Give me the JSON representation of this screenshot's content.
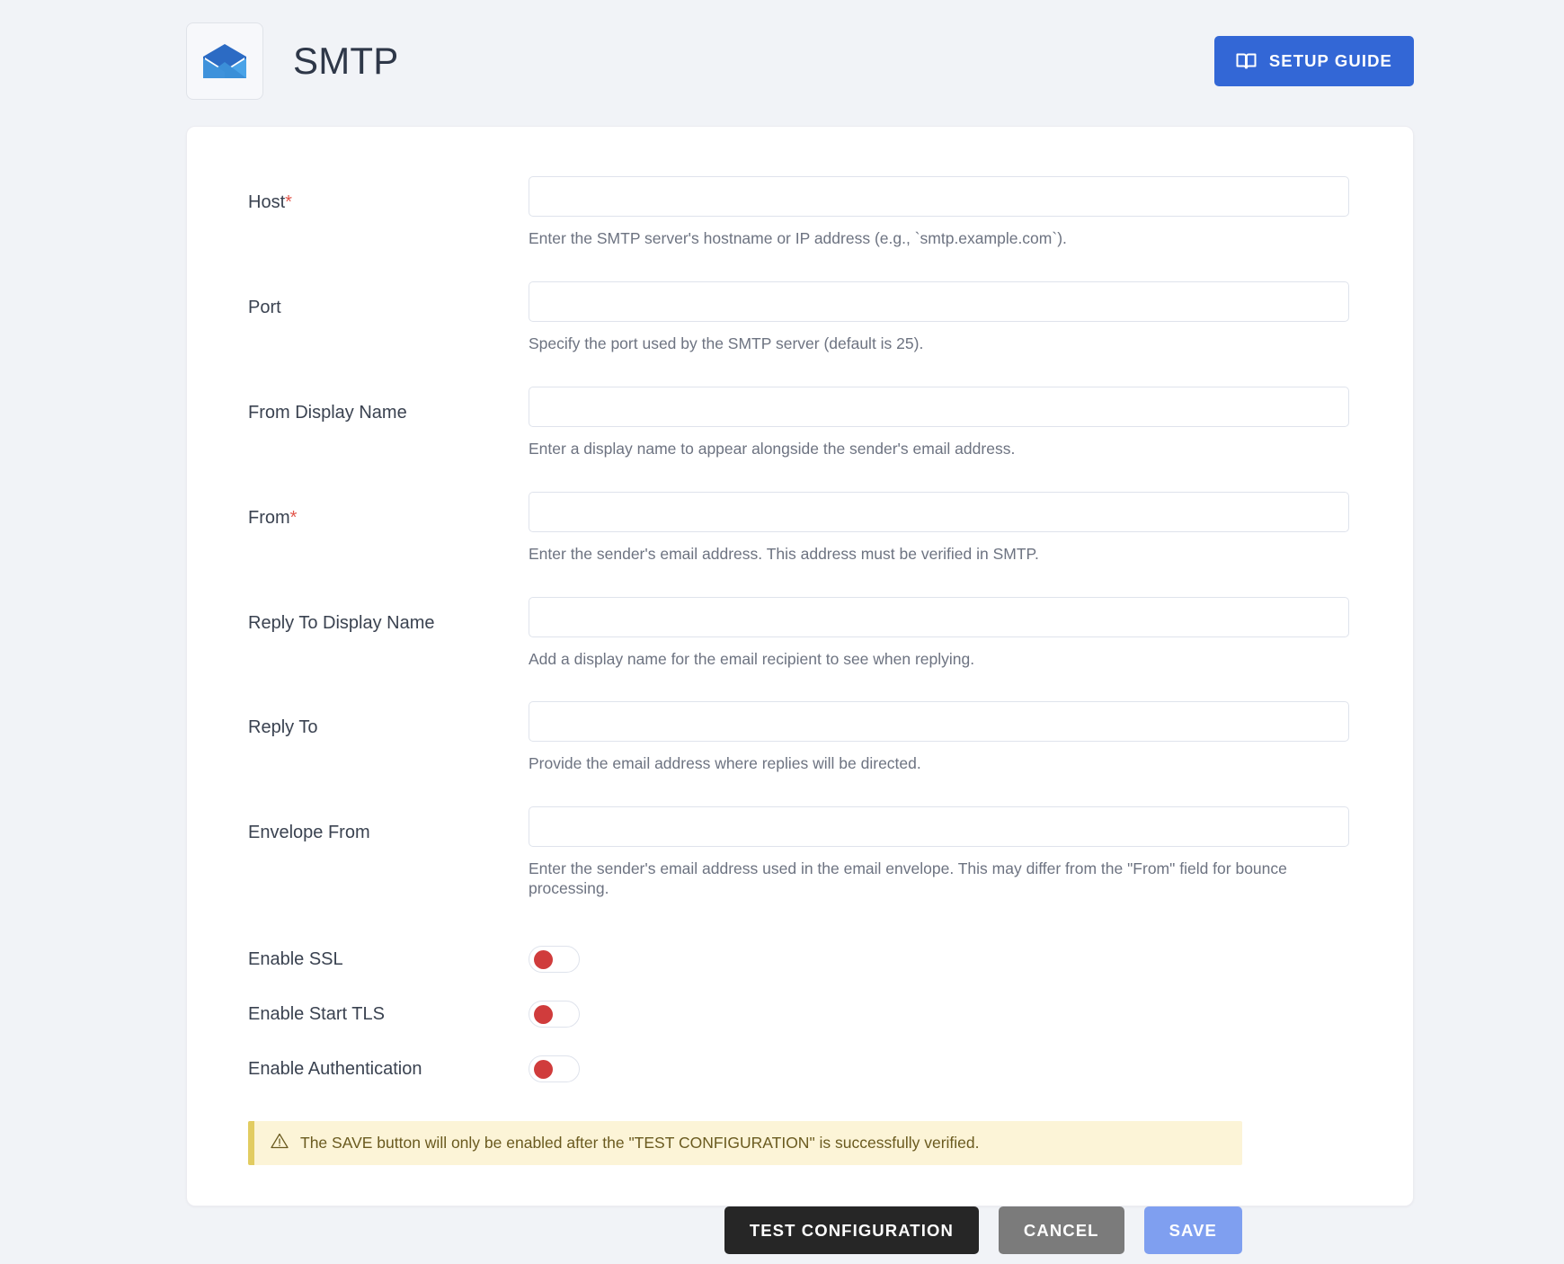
{
  "header": {
    "title": "SMTP",
    "app_icon": "envelope-open-icon",
    "setup_guide": {
      "label": "SETUP GUIDE",
      "icon": "book-icon",
      "color": "#3367d6"
    }
  },
  "form": {
    "fields": [
      {
        "label": "Host",
        "required": true,
        "value": "",
        "placeholder": "",
        "hint": "Enter the SMTP server's hostname or IP address (e.g., `smtp.example.com`)."
      },
      {
        "label": "Port",
        "required": false,
        "value": "",
        "placeholder": "",
        "hint": "Specify the port used by the SMTP server (default is 25)."
      },
      {
        "label": "From Display Name",
        "required": false,
        "value": "",
        "placeholder": "",
        "hint": "Enter a display name to appear alongside the sender's email address."
      },
      {
        "label": "From",
        "required": true,
        "value": "",
        "placeholder": "",
        "hint": "Enter the sender's email address. This address must be verified in SMTP."
      },
      {
        "label": "Reply To Display Name",
        "required": false,
        "value": "",
        "placeholder": "",
        "hint": "Add a display name for the email recipient to see when replying."
      },
      {
        "label": "Reply To",
        "required": false,
        "value": "",
        "placeholder": "",
        "hint": "Provide the email address where replies will be directed."
      },
      {
        "label": "Envelope From",
        "required": false,
        "value": "",
        "placeholder": "",
        "hint": "Enter the sender's email address used in the email envelope. This may differ from the \"From\" field for bounce processing."
      }
    ],
    "toggles": [
      {
        "label": "Enable SSL",
        "state": "off"
      },
      {
        "label": "Enable Start TLS",
        "state": "off"
      },
      {
        "label": "Enable Authentication",
        "state": "off"
      }
    ],
    "warning": {
      "icon": "warning-triangle-icon",
      "text": "The SAVE button will only be enabled after the \"TEST CONFIGURATION\" is successfully verified.",
      "background": "#fcf4d7",
      "accent": "#e2cc61"
    },
    "actions": {
      "test": {
        "label": "TEST CONFIGURATION",
        "color": "#262626"
      },
      "cancel": {
        "label": "CANCEL",
        "color": "#7b7b7b"
      },
      "save": {
        "label": "SAVE",
        "color": "#7f9ff0",
        "disabled": true
      }
    }
  }
}
